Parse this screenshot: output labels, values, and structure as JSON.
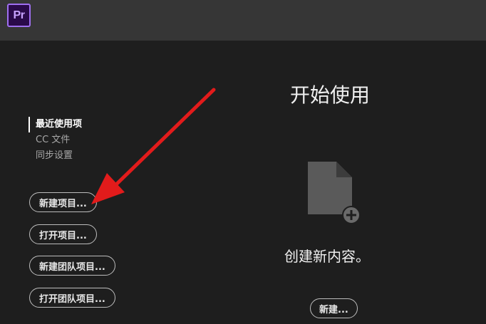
{
  "app": {
    "logo_text": "Pr",
    "accent_color": "#9f6ff0"
  },
  "nav": {
    "items": [
      {
        "label": "最近使用项",
        "active": true
      },
      {
        "label": "CC 文件",
        "active": false
      },
      {
        "label": "同步设置",
        "active": false
      }
    ]
  },
  "actions": {
    "new_project": "新建项目...",
    "open_project": "打开项目...",
    "new_team_project": "新建团队项目...",
    "open_team_project": "打开团队项目..."
  },
  "getting_started": {
    "title": "开始使用",
    "icon": "new-file-plus-icon",
    "prompt": "创建新内容。",
    "new_button": "新建..."
  },
  "annotation": {
    "icon": "red-arrow-icon",
    "color": "#e21b1b"
  }
}
